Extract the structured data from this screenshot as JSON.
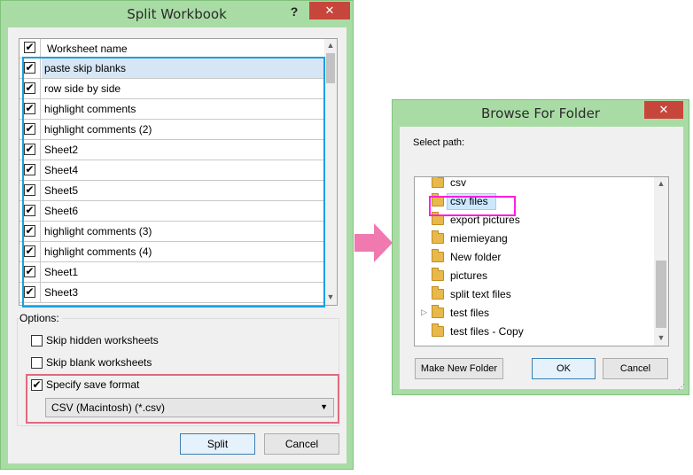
{
  "split_dialog": {
    "title": "Split Workbook",
    "help_label": "?",
    "close_label": "✕",
    "header": "Worksheet name",
    "header_checked": "✔",
    "sheets": [
      {
        "name": "paste skip blanks",
        "checked": "✔"
      },
      {
        "name": "row side by side",
        "checked": "✔"
      },
      {
        "name": "highlight comments",
        "checked": "✔"
      },
      {
        "name": "highlight comments (2)",
        "checked": "✔"
      },
      {
        "name": "Sheet2",
        "checked": "✔"
      },
      {
        "name": "Sheet4",
        "checked": "✔"
      },
      {
        "name": "Sheet5",
        "checked": "✔"
      },
      {
        "name": "Sheet6",
        "checked": "✔"
      },
      {
        "name": "highlight comments (3)",
        "checked": "✔"
      },
      {
        "name": "highlight comments (4)",
        "checked": "✔"
      },
      {
        "name": "Sheet1",
        "checked": "✔"
      },
      {
        "name": "Sheet3",
        "checked": "✔"
      }
    ],
    "options_label": "Options:",
    "skip_hidden_label": "Skip hidden worksheets",
    "skip_blank_label": "Skip blank worksheets",
    "specify_format_label": "Specify save format",
    "specify_format_checked": "✔",
    "format_value": "CSV (Macintosh) (*.csv)",
    "split_label": "Split",
    "cancel_label": "Cancel"
  },
  "browse_dialog": {
    "title": "Browse For Folder",
    "close_label": "✕",
    "select_path_label": "Select path:",
    "folders": [
      {
        "name": "csv"
      },
      {
        "name": "csv files"
      },
      {
        "name": "export pictures"
      },
      {
        "name": "miemieyang"
      },
      {
        "name": "New folder"
      },
      {
        "name": "pictures"
      },
      {
        "name": "split text files"
      },
      {
        "name": "test files"
      },
      {
        "name": "test files - Copy"
      }
    ],
    "make_new_folder_label": "Make New Folder",
    "ok_label": "OK",
    "cancel_label": "Cancel"
  },
  "colors": {
    "window_frame": "#a9dca5",
    "close_button": "#c7463b",
    "sheet_highlight": "#1b9fe0",
    "format_highlight": "#e06a7d",
    "folder_highlight": "#ff1ee0",
    "arrow": "#f07ab0"
  }
}
